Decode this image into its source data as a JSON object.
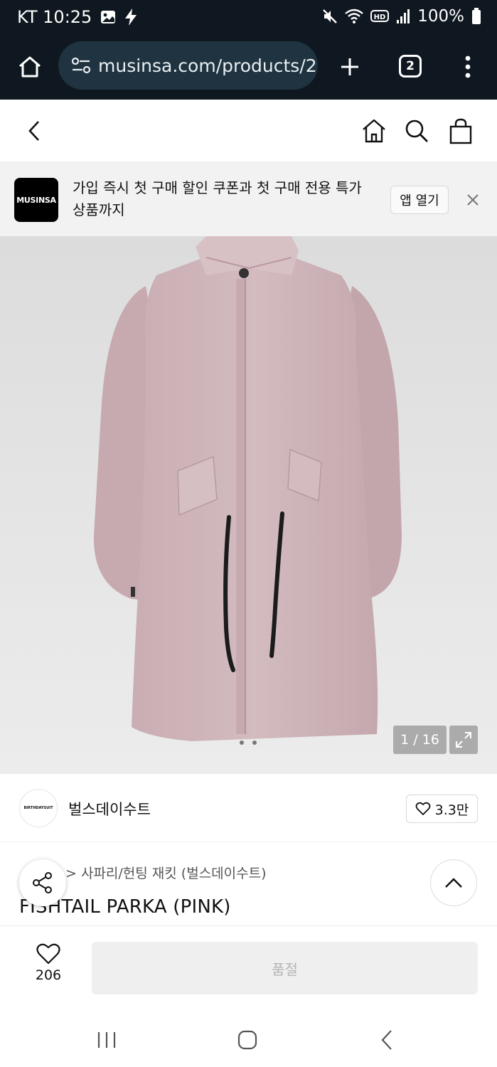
{
  "status_bar": {
    "carrier_time": "KT 10:25",
    "battery": "100%",
    "icons": [
      "gallery-icon",
      "bolt-icon",
      "mute-icon",
      "wifi-icon",
      "hd-icon",
      "signal-icon",
      "battery-icon"
    ]
  },
  "browser": {
    "url": "musinsa.com/products/2",
    "tab_count": "2",
    "icons": [
      "home-icon",
      "site-settings-icon",
      "plus-icon",
      "tabs-icon",
      "more-icon"
    ]
  },
  "site_header": {
    "icons": [
      "back-icon",
      "home-icon",
      "search-icon",
      "bag-icon"
    ]
  },
  "banner": {
    "logo_text": "MUSINSA",
    "message": "가입 즉시 첫 구매 할인 쿠폰과 첫 구매 전용 특가 상품까지",
    "open_app_label": "앱 열기"
  },
  "gallery": {
    "counter": "1 / 16"
  },
  "brand": {
    "logo_text": "BIRTHDAYSUIT",
    "name": "벌스데이수트",
    "likes": "3.3만"
  },
  "product": {
    "breadcrumb": "> 사파리/헌팅 재킷 (벌스데이수트)",
    "title": "FISHTAIL PARKA (PINK)",
    "image_colors": {
      "garment": "#cdb3b8",
      "background": "#e2e2e2"
    }
  },
  "action_bar": {
    "like_count": "206",
    "soldout_label": "품절"
  }
}
